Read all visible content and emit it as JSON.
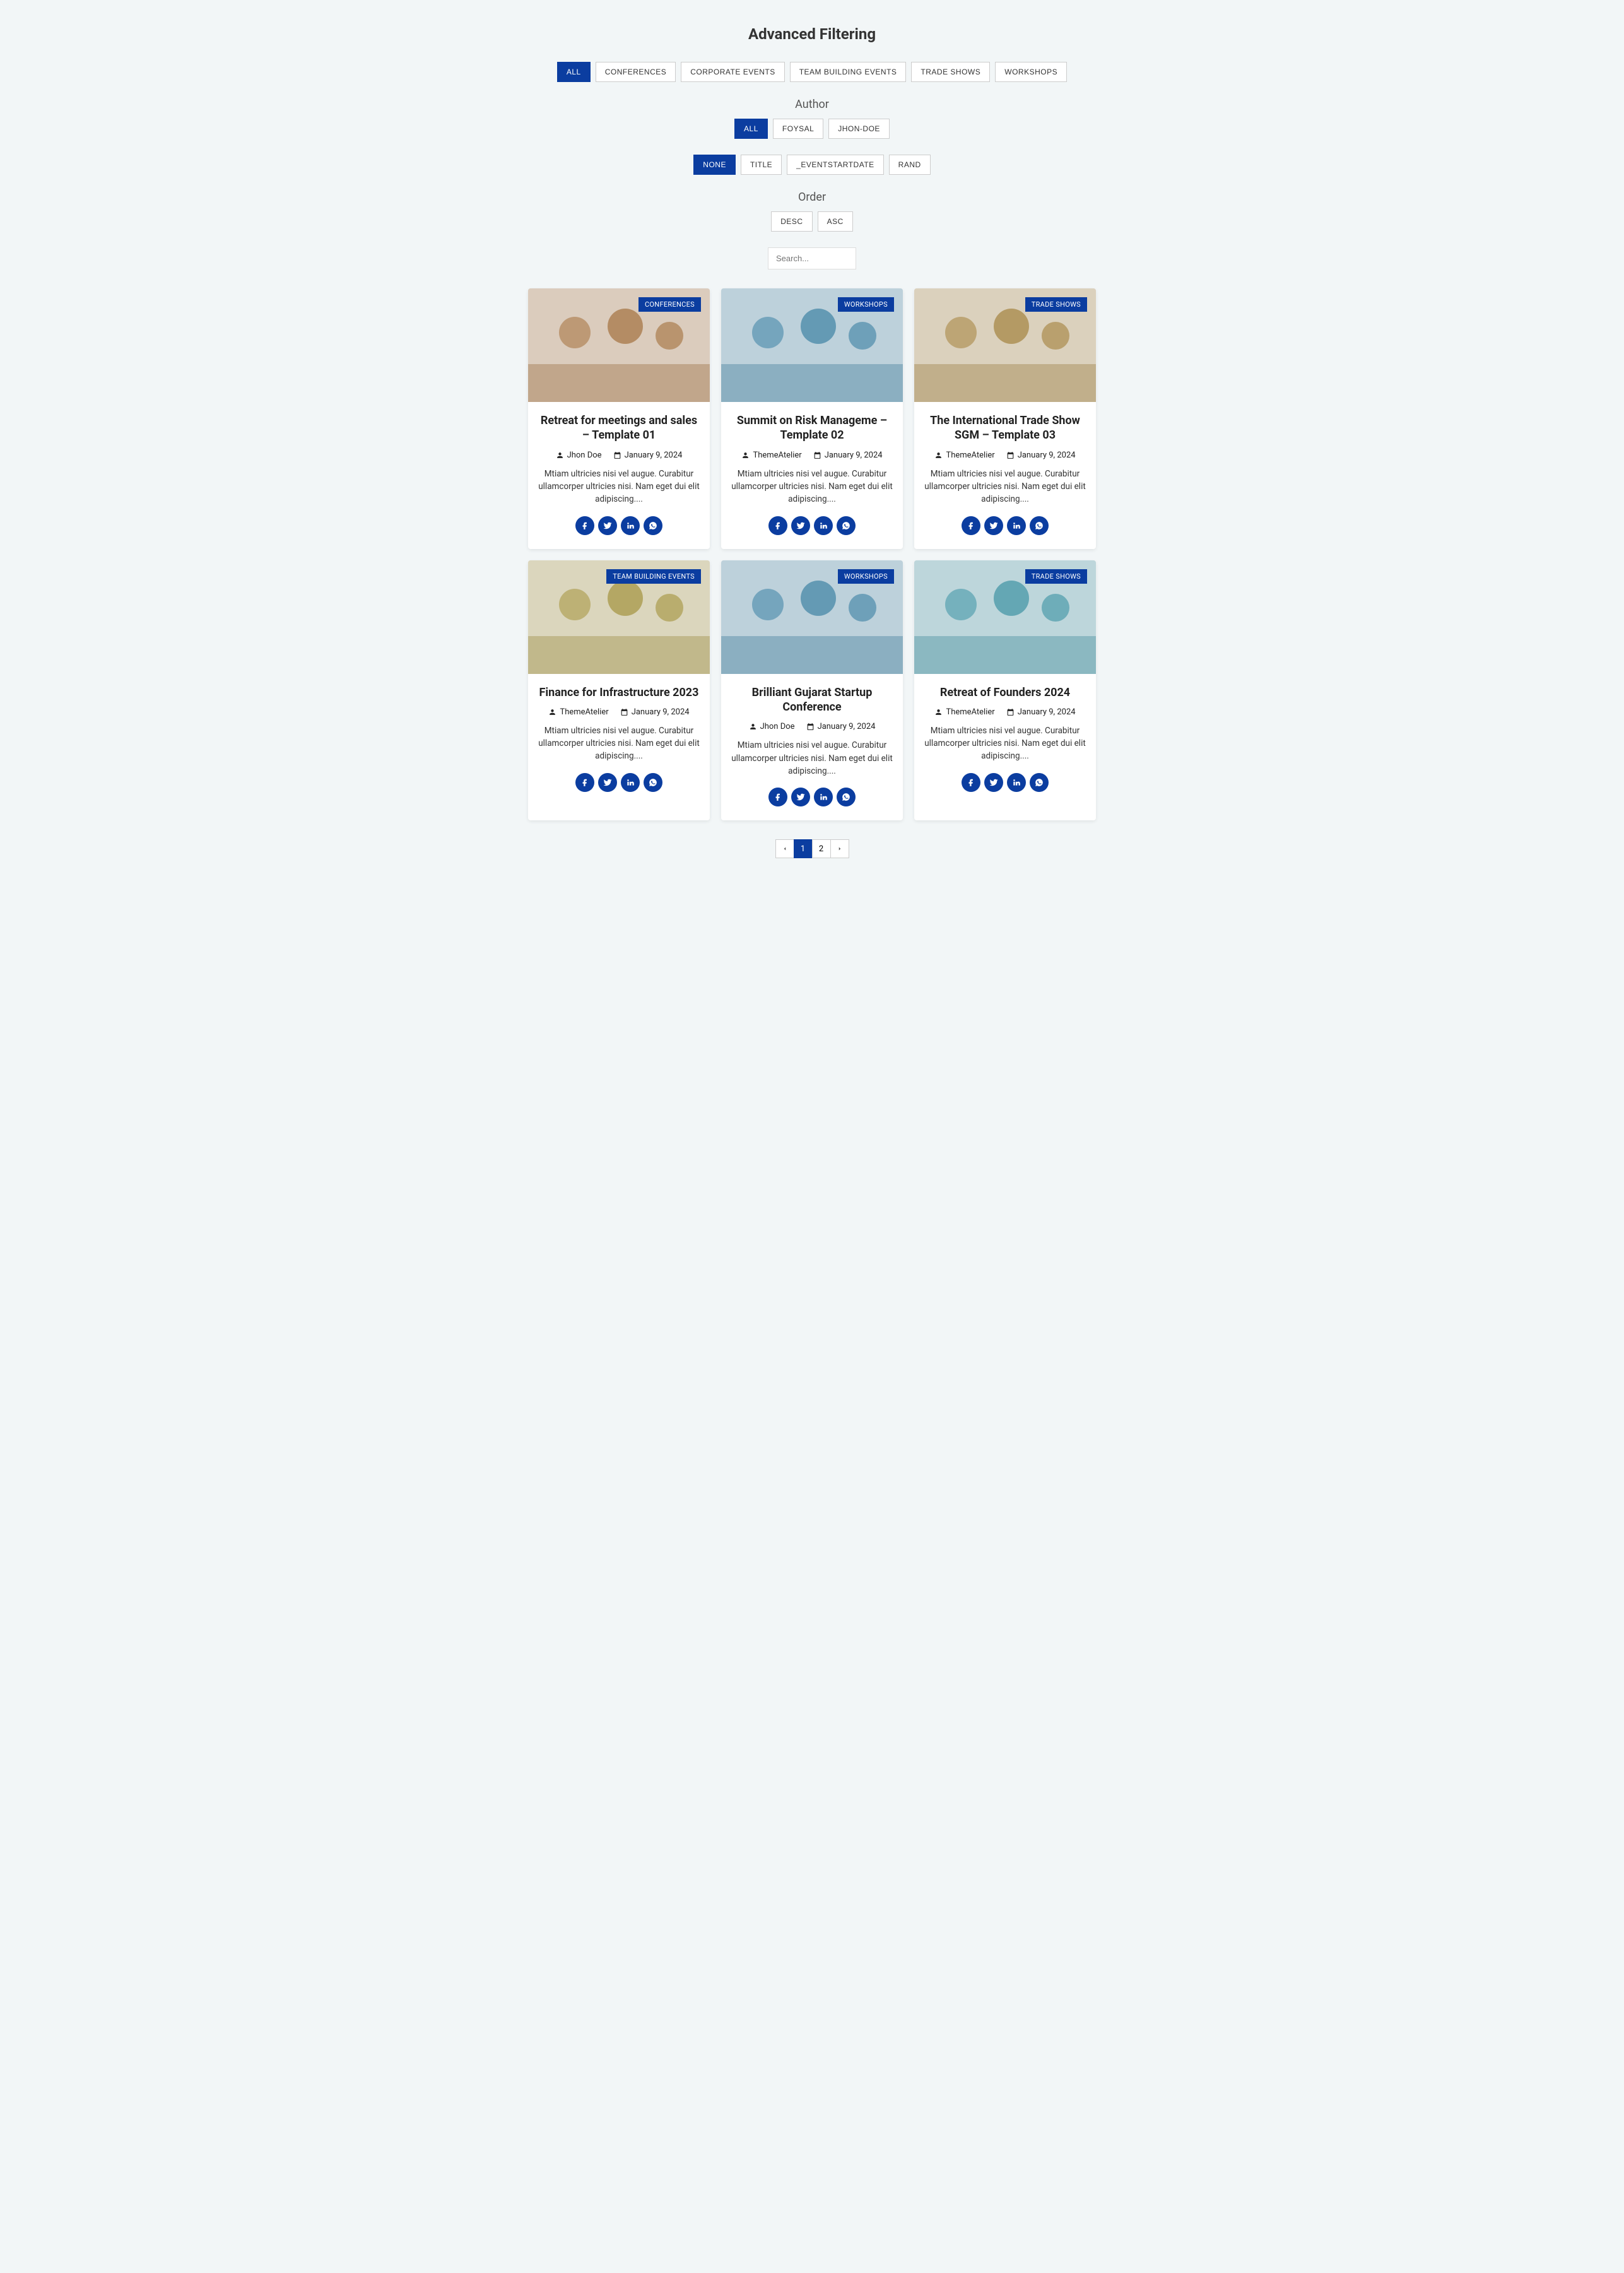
{
  "title": "Advanced Filtering",
  "filters": {
    "categories": {
      "items": [
        {
          "label": "ALL",
          "active": true
        },
        {
          "label": "CONFERENCES",
          "active": false
        },
        {
          "label": "CORPORATE EVENTS",
          "active": false
        },
        {
          "label": "TEAM BUILDING EVENTS",
          "active": false
        },
        {
          "label": "TRADE SHOWS",
          "active": false
        },
        {
          "label": "WORKSHOPS",
          "active": false
        }
      ]
    },
    "author": {
      "label": "Author",
      "items": [
        {
          "label": "ALL",
          "active": true
        },
        {
          "label": "FOYSAL",
          "active": false
        },
        {
          "label": "JHON-DOE",
          "active": false
        }
      ]
    },
    "sort": {
      "items": [
        {
          "label": "NONE",
          "active": true
        },
        {
          "label": "TITLE",
          "active": false
        },
        {
          "label": "_EVENTSTARTDATE",
          "active": false
        },
        {
          "label": "RAND",
          "active": false
        }
      ]
    },
    "order": {
      "label": "Order",
      "items": [
        {
          "label": "DESC",
          "active": false
        },
        {
          "label": "ASC",
          "active": false
        }
      ]
    }
  },
  "search": {
    "placeholder": "Search..."
  },
  "cards": [
    {
      "tag": "CONFERENCES",
      "title": "Retreat for meetings and sales – Template 01",
      "author": "Jhon Doe",
      "date": "January 9, 2024",
      "excerpt": "Mtiam ultricies nisi vel augue. Curabitur ullamcorper ultricies nisi. Nam eget dui elit adipiscing...."
    },
    {
      "tag": "WORKSHOPS",
      "title": "Summit on Risk Manageme – Template 02",
      "author": "ThemeAtelier",
      "date": "January 9, 2024",
      "excerpt": "Mtiam ultricies nisi vel augue. Curabitur ullamcorper ultricies nisi. Nam eget dui elit adipiscing...."
    },
    {
      "tag": "TRADE SHOWS",
      "title": "The International Trade Show SGM – Template 03",
      "author": "ThemeAtelier",
      "date": "January 9, 2024",
      "excerpt": "Mtiam ultricies nisi vel augue. Curabitur ullamcorper ultricies nisi. Nam eget dui elit adipiscing...."
    },
    {
      "tag": "TEAM BUILDING EVENTS",
      "title": "Finance for Infrastructure 2023",
      "author": "ThemeAtelier",
      "date": "January 9, 2024",
      "excerpt": "Mtiam ultricies nisi vel augue. Curabitur ullamcorper ultricies nisi. Nam eget dui elit adipiscing...."
    },
    {
      "tag": "WORKSHOPS",
      "title": "Brilliant Gujarat Startup Conference",
      "author": "Jhon Doe",
      "date": "January 9, 2024",
      "excerpt": "Mtiam ultricies nisi vel augue. Curabitur ullamcorper ultricies nisi. Nam eget dui elit adipiscing...."
    },
    {
      "tag": "TRADE SHOWS",
      "title": "Retreat of Founders 2024",
      "author": "ThemeAtelier",
      "date": "January 9, 2024",
      "excerpt": "Mtiam ultricies nisi vel augue. Curabitur ullamcorper ultricies nisi. Nam eget dui elit adipiscing...."
    }
  ],
  "pagination": {
    "current": 1,
    "pages": [
      1,
      2
    ]
  },
  "social_icons": [
    "facebook",
    "twitter",
    "linkedin",
    "whatsapp"
  ]
}
